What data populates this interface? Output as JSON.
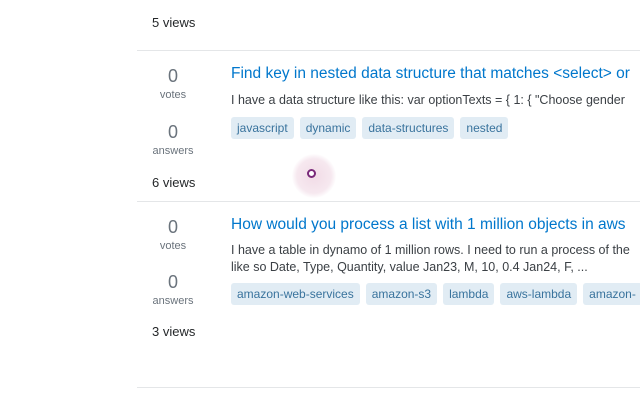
{
  "questions": [
    {
      "views": "5 views"
    },
    {
      "votes_count": "0",
      "votes_label": "votes",
      "answers_count": "0",
      "answers_label": "answers",
      "views": "6 views",
      "title": "Find key in nested data structure that matches <select> or",
      "excerpt": "I have a data structure like this: var optionTexts = { 1: { \"Choose gender",
      "tags": [
        "javascript",
        "dynamic",
        "data-structures",
        "nested"
      ]
    },
    {
      "votes_count": "0",
      "votes_label": "votes",
      "answers_count": "0",
      "answers_label": "answers",
      "views": "3 views",
      "title": "How would you process a list with 1 million objects in aws",
      "excerpt_line1": "I have a table in dynamo of 1 million rows. I need to run a process of the",
      "excerpt_line2": "like so Date, Type, Quantity, value Jan23, M, 10, 0.4 Jan24, F, ...",
      "tags": [
        "amazon-web-services",
        "amazon-s3",
        "lambda",
        "aws-lambda",
        "amazon-"
      ]
    }
  ]
}
